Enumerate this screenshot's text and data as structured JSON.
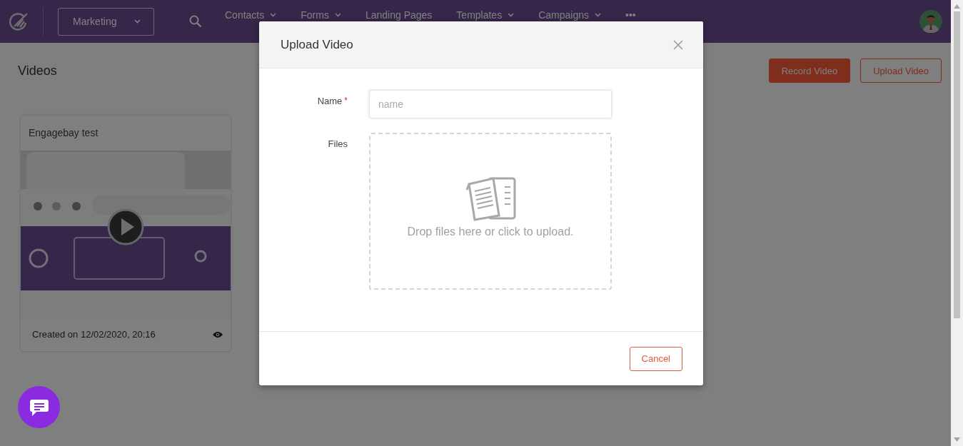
{
  "header": {
    "workspace": "Marketing",
    "nav": [
      {
        "label": "Contacts",
        "has_menu": true
      },
      {
        "label": "Forms",
        "has_menu": true
      },
      {
        "label": "Landing Pages",
        "has_menu": false
      },
      {
        "label": "Templates",
        "has_menu": true
      },
      {
        "label": "Campaigns",
        "has_menu": true
      },
      {
        "label": "•••",
        "has_menu": false
      }
    ]
  },
  "page": {
    "title": "Videos",
    "buttons": [
      {
        "label": "Record Video",
        "kind": "primary"
      },
      {
        "label": "Upload Video",
        "kind": "outline"
      }
    ]
  },
  "videos": [
    {
      "title": "Engagebay test",
      "created": "Created on 12/02/2020, 20:16"
    }
  ],
  "modal": {
    "title": "Upload Video",
    "fields": [
      {
        "label": "Name",
        "required_mark": "*",
        "kind": "text",
        "placeholder": "name"
      },
      {
        "label": "Files",
        "kind": "dropzone",
        "hint": "Drop files here or click to upload."
      }
    ],
    "buttons": [
      {
        "label": "Cancel"
      }
    ]
  }
}
